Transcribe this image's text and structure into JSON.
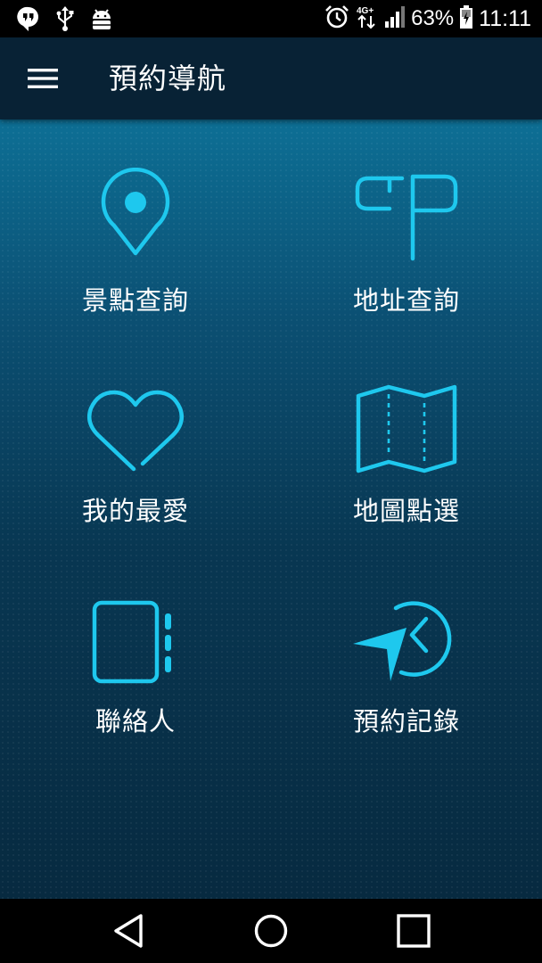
{
  "status_bar": {
    "battery": "63%",
    "time": "11:11",
    "network": "4G+",
    "icons": [
      "hangouts-icon",
      "usb-icon",
      "android-debug-icon",
      "alarm-icon",
      "network-4g-icon",
      "signal-icon",
      "battery-charging-icon"
    ]
  },
  "app_bar": {
    "title": "預約導航",
    "menu_icon": "hamburger-menu-icon"
  },
  "menu": {
    "items": [
      {
        "label": "景點查詢",
        "icon": "location-pin-icon"
      },
      {
        "label": "地址查詢",
        "icon": "signpost-icon"
      },
      {
        "label": "我的最愛",
        "icon": "heart-icon"
      },
      {
        "label": "地圖點選",
        "icon": "folded-map-icon"
      },
      {
        "label": "聯絡人",
        "icon": "contacts-book-icon"
      },
      {
        "label": "預約記錄",
        "icon": "history-icon"
      }
    ]
  },
  "nav_bar": {
    "buttons": [
      "back-icon",
      "home-icon",
      "recents-icon"
    ]
  },
  "colors": {
    "accent": "#1ec8ee",
    "app_bar": "#082235",
    "background_top": "#0d6f95",
    "background_bottom": "#072a40"
  }
}
